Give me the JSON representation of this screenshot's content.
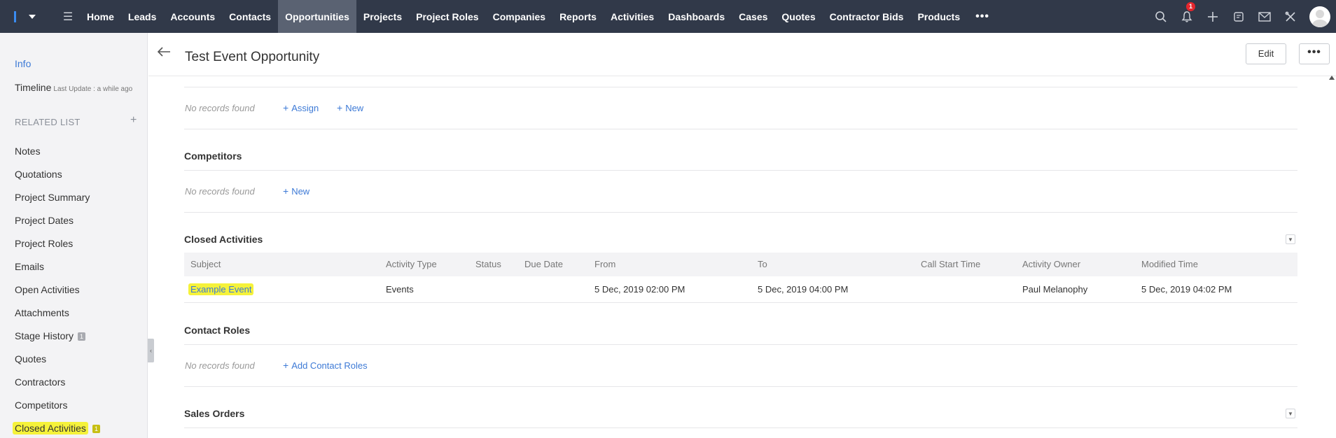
{
  "topnav": {
    "items": [
      "Home",
      "Leads",
      "Accounts",
      "Contacts",
      "Opportunities",
      "Projects",
      "Project Roles",
      "Companies",
      "Reports",
      "Activities",
      "Dashboards",
      "Cases",
      "Quotes",
      "Contractor Bids",
      "Products"
    ],
    "active": "Opportunities",
    "more_label": "•••",
    "notification_count": "1"
  },
  "sidebar": {
    "info_label": "Info",
    "timeline_label": "Timeline",
    "timeline_update": "Last Update : a while ago",
    "related_list_label": "RELATED LIST",
    "items": [
      {
        "label": "Notes",
        "count": ""
      },
      {
        "label": "Quotations",
        "count": ""
      },
      {
        "label": "Project Summary",
        "count": ""
      },
      {
        "label": "Project Dates",
        "count": ""
      },
      {
        "label": "Project Roles",
        "count": ""
      },
      {
        "label": "Emails",
        "count": ""
      },
      {
        "label": "Open Activities",
        "count": ""
      },
      {
        "label": "Attachments",
        "count": ""
      },
      {
        "label": "Stage History",
        "count": "1"
      },
      {
        "label": "Quotes",
        "count": ""
      },
      {
        "label": "Contractors",
        "count": ""
      },
      {
        "label": "Competitors",
        "count": ""
      },
      {
        "label": "Closed Activities",
        "count": "1"
      }
    ]
  },
  "header": {
    "title": "Test Event Opportunity",
    "edit_label": "Edit",
    "more_label": "•••"
  },
  "sections": {
    "top": {
      "no_records": "No records found",
      "assign_label": "Assign",
      "new_label": "New"
    },
    "competitors": {
      "title": "Competitors",
      "no_records": "No records found",
      "new_label": "New"
    },
    "closed_activities": {
      "title": "Closed Activities",
      "columns": [
        "Subject",
        "Activity Type",
        "Status",
        "Due Date",
        "From",
        "To",
        "Call Start Time",
        "Activity Owner",
        "Modified Time"
      ],
      "rows": [
        [
          "Example Event",
          "Events",
          "",
          "",
          "5 Dec, 2019 02:00 PM",
          "5 Dec, 2019 04:00 PM",
          "",
          "Paul Melanophy",
          "5 Dec, 2019 04:02 PM"
        ]
      ]
    },
    "contact_roles": {
      "title": "Contact Roles",
      "no_records": "No records found",
      "add_label": "Add Contact Roles"
    },
    "sales_orders": {
      "title": "Sales Orders"
    }
  },
  "colors": {
    "nav_bg": "#313949",
    "link": "#3d7ad6",
    "highlight": "#f5f23a"
  }
}
